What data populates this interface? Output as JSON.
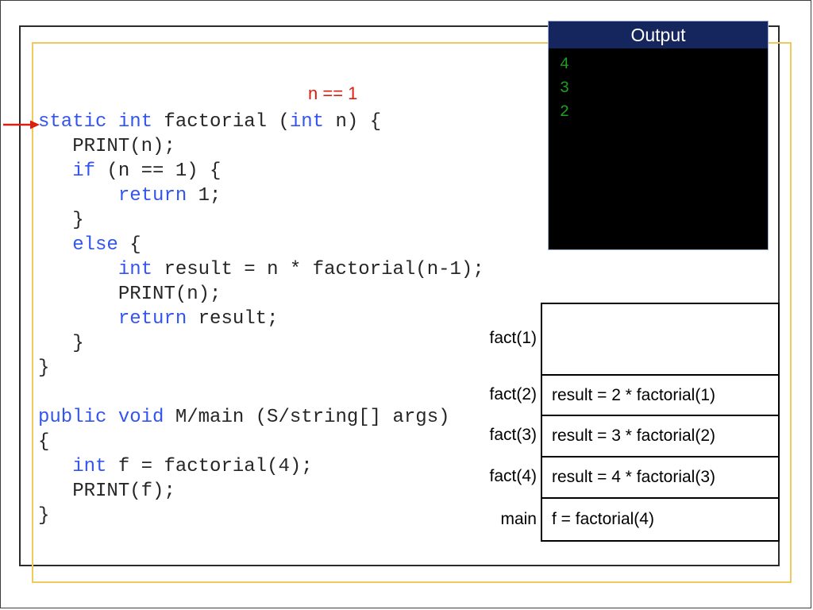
{
  "annotation": {
    "condition_label": "n == 1",
    "condition_color": "#d91f11",
    "arrow_color": "#d91f11"
  },
  "code": {
    "keyword_color": "#3355ee",
    "text_color": "#262626",
    "lines": [
      [
        {
          "t": "static int",
          "k": true
        },
        {
          "t": " factorial (",
          "k": false
        },
        {
          "t": "int",
          "k": true
        },
        {
          "t": " n) {",
          "k": false
        }
      ],
      [
        {
          "t": "   PRINT(n);",
          "k": false
        }
      ],
      [
        {
          "t": "   ",
          "k": false
        },
        {
          "t": "if",
          "k": true
        },
        {
          "t": " (n == 1) {",
          "k": false
        }
      ],
      [
        {
          "t": "       ",
          "k": false
        },
        {
          "t": "return",
          "k": true
        },
        {
          "t": " 1;",
          "k": false
        }
      ],
      [
        {
          "t": "   }",
          "k": false
        }
      ],
      [
        {
          "t": "   ",
          "k": false
        },
        {
          "t": "else",
          "k": true
        },
        {
          "t": " {",
          "k": false
        }
      ],
      [
        {
          "t": "       ",
          "k": false
        },
        {
          "t": "int",
          "k": true
        },
        {
          "t": " result = n * factorial(n-1);",
          "k": false
        }
      ],
      [
        {
          "t": "       PRINT(n);",
          "k": false
        }
      ],
      [
        {
          "t": "       ",
          "k": false
        },
        {
          "t": "return",
          "k": true
        },
        {
          "t": " result;",
          "k": false
        }
      ],
      [
        {
          "t": "   }",
          "k": false
        }
      ],
      [
        {
          "t": "}",
          "k": false
        }
      ],
      [
        {
          "t": "",
          "k": false
        }
      ],
      [
        {
          "t": "public void",
          "k": true
        },
        {
          "t": " M/main (S/string[] args)",
          "k": false
        }
      ],
      [
        {
          "t": "{",
          "k": false
        }
      ],
      [
        {
          "t": "   ",
          "k": false
        },
        {
          "t": "int",
          "k": true
        },
        {
          "t": " f = factorial(4);",
          "k": false
        }
      ],
      [
        {
          "t": "   PRINT(f);",
          "k": false
        }
      ],
      [
        {
          "t": "}",
          "k": false
        }
      ]
    ]
  },
  "output": {
    "title": "Output",
    "header_color": "#15265e",
    "background_color": "#000000",
    "text_color": "#1f9e1f",
    "lines": [
      "4",
      "3",
      "2"
    ]
  },
  "call_stack": {
    "rows": [
      {
        "label": "fact(1)",
        "value": ""
      },
      {
        "label": "fact(2)",
        "value": "result = 2 * factorial(1)"
      },
      {
        "label": "fact(3)",
        "value": "result = 3 * factorial(2)"
      },
      {
        "label": "fact(4)",
        "value": "result = 4 * factorial(3)"
      },
      {
        "label": "main",
        "value": "f = factorial(4)"
      }
    ]
  },
  "frames": {
    "dark_border_color": "#2b2b2b",
    "gold_border_color": "#f2c75c",
    "page_border_color": "#3f3f3f"
  }
}
